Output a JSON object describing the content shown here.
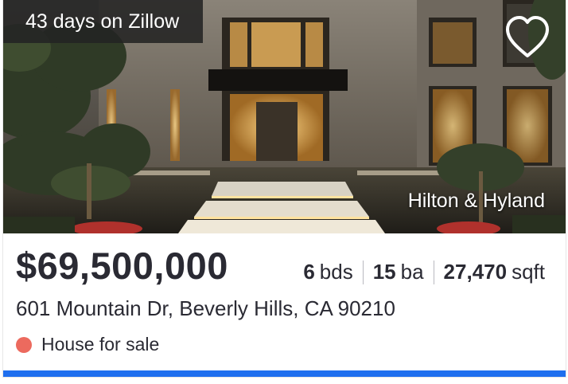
{
  "listing": {
    "days_on_site": "43 days on Zillow",
    "brokerage": "Hilton & Hyland",
    "price": "$69,500,000",
    "beds": {
      "value": "6",
      "unit": "bds"
    },
    "baths": {
      "value": "15",
      "unit": "ba"
    },
    "area": {
      "value": "27,470",
      "unit": "sqft"
    },
    "address": "601 Mountain Dr, Beverly Hills, CA 90210",
    "status": "House for sale"
  },
  "icons": {
    "favorite": "heart-outline-icon",
    "status": "status-dot-icon"
  },
  "colors": {
    "status_dot": "#ec6a5e",
    "accent_bar": "#1f6fef",
    "text": "#2a2a33"
  }
}
